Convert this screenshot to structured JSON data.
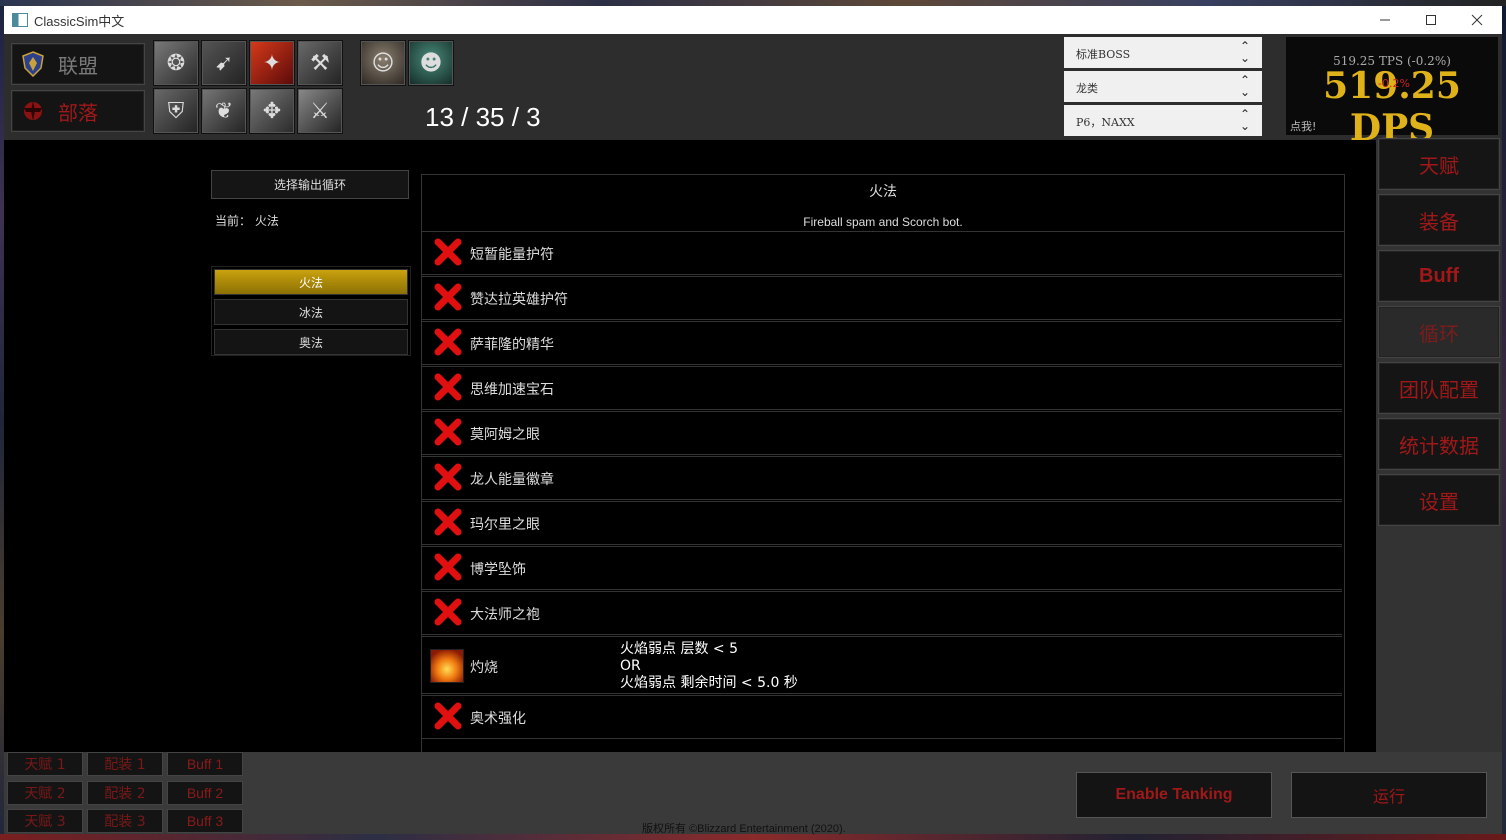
{
  "window": {
    "title": "ClassicSim中文"
  },
  "factions": {
    "alliance": "联盟",
    "horde": "部落"
  },
  "talents": {
    "counts": "13 / 35 / 3"
  },
  "selects": {
    "target": "标准BOSS",
    "creature_type": "龙类",
    "phase": "P6，NAXX"
  },
  "stats": {
    "tps": "519.25 TPS (-0.2%)",
    "dps": "519.25 DPS",
    "delta": "-0.2%",
    "click_me": "点我!"
  },
  "nav": {
    "talents": "天赋",
    "gear": "装备",
    "buff": "Buff",
    "rotation": "循环",
    "raid": "团队配置",
    "statistics": "统计数据",
    "settings": "设置"
  },
  "rotation_page": {
    "select_button": "选择输出循环",
    "current": "当前： 火法",
    "options": [
      "火法",
      "冰法",
      "奥法"
    ],
    "name": "火法",
    "description": "Fireball spam and Scorch bot.",
    "spells": [
      {
        "name": "短暂能量护符"
      },
      {
        "name": "赞达拉英雄护符"
      },
      {
        "name": "萨菲隆的精华"
      },
      {
        "name": "思维加速宝石"
      },
      {
        "name": "莫阿姆之眼"
      },
      {
        "name": "龙人能量徽章"
      },
      {
        "name": "玛尔里之眼"
      },
      {
        "name": "博学坠饰"
      },
      {
        "name": "大法师之袍"
      }
    ],
    "scorch": {
      "name": "灼烧",
      "cond1": "火焰弱点 层数 < 5",
      "cond2": "OR",
      "cond3": "火焰弱点 剩余时间 < 5.0 秒"
    },
    "last_spell": "奥术强化"
  },
  "presets": {
    "talents": [
      "天赋 1",
      "天赋 2",
      "天赋 3"
    ],
    "gear": [
      "配装 1",
      "配装 2",
      "配装 3"
    ],
    "buffs": [
      "Buff 1",
      "Buff 2",
      "Buff 3"
    ]
  },
  "actions": {
    "tanking": "Enable Tanking",
    "run": "运行"
  },
  "footer": {
    "copyright": "版权所有 ©Blizzard Entertainment (2020)."
  }
}
